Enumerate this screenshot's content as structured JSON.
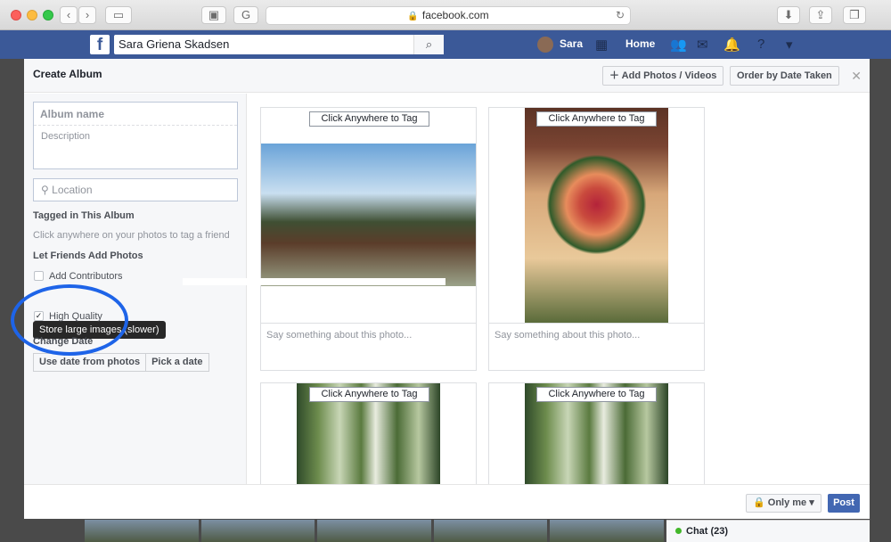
{
  "browser": {
    "url": "facebook.com"
  },
  "fb": {
    "search_value": "Sara Griena Skadsen",
    "user_name": "Sara",
    "home_label": "Home"
  },
  "modal": {
    "title": "Create Album",
    "add_photos_label": "Add Photos / Videos",
    "order_label": "Order by Date Taken",
    "album_name_placeholder": "Album name",
    "description_placeholder": "Description",
    "location_placeholder": "Location",
    "tagged_heading": "Tagged in This Album",
    "tagged_hint": "Click anywhere on your photos to tag a friend",
    "friends_heading": "Let Friends Add Photos",
    "contributors_label": "Add Contributors",
    "tooltip": "Store large images (slower)",
    "high_quality_label": "High Quality",
    "change_date_heading": "Change Date",
    "use_date_btn": "Use date from photos",
    "pick_date_btn": "Pick a date",
    "privacy_label": "Only me",
    "post_label": "Post"
  },
  "photos": [
    {
      "tag_label": "Click Anywhere to Tag",
      "caption_placeholder": "Say something about this photo..."
    },
    {
      "tag_label": "Click Anywhere to Tag",
      "caption_placeholder": "Say something about this photo..."
    },
    {
      "tag_label": "Click Anywhere to Tag"
    },
    {
      "tag_label": "Click Anywhere to Tag"
    }
  ],
  "chat": {
    "label": "Chat (23)"
  },
  "colors": {
    "fb_blue": "#3b5998",
    "post_blue": "#4267b2",
    "annotation_circle": "#1e64e8"
  }
}
